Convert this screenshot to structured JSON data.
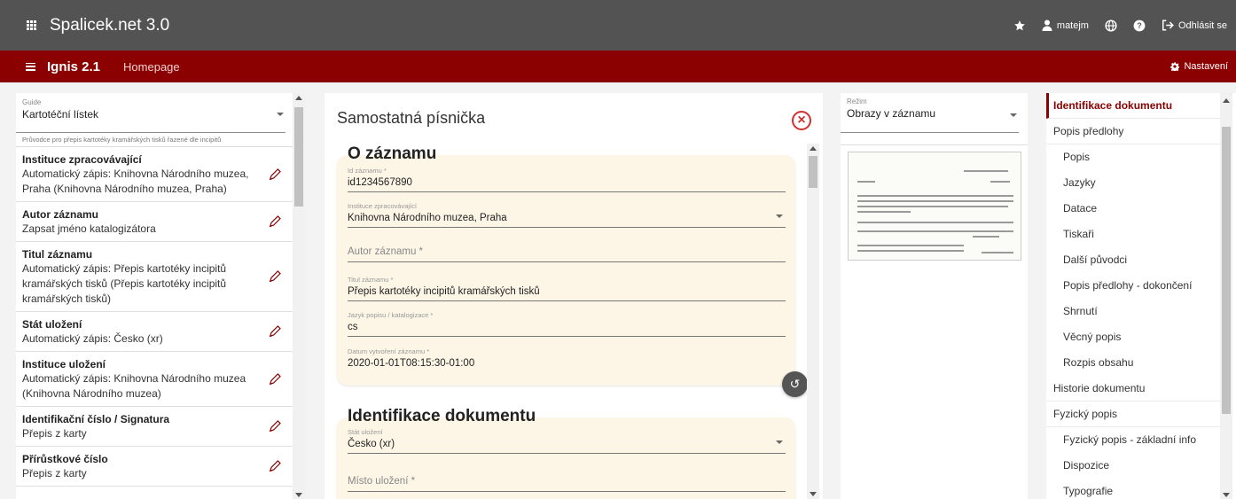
{
  "app": {
    "title": "Spalicek.net 3.0",
    "user": "matejm",
    "logout": "Odhlásit se"
  },
  "subbar": {
    "title": "Ignis 2.1",
    "homepage": "Homepage",
    "settings": "Nastavení"
  },
  "guide": {
    "label": "Guide",
    "value": "Kartotéční lístek",
    "hint": "Průvodce pro přepis kartotéky kramářských tisků řazené dle incipitů",
    "items": [
      {
        "title": "Instituce zpracovávající",
        "desc": "Automatický zápis: Knihovna Národního muzea, Praha (Knihovna Národního muzea, Praha)"
      },
      {
        "title": "Autor záznamu",
        "desc": "Zapsat jméno katalogizátora"
      },
      {
        "title": "Titul záznamu",
        "desc": "Automatický zápis: Přepis kartotéky incipitů kramářských tisků (Přepis kartotéky incipitů kramářských tisků)"
      },
      {
        "title": "Stát uložení",
        "desc": "Automatický zápis: Česko (xr)"
      },
      {
        "title": "Instituce uložení",
        "desc": "Automatický zápis: Knihovna Národního muzea (Knihovna Národního muzea)"
      },
      {
        "title": "Identifikační číslo / Signatura",
        "desc": "Přepis z karty"
      },
      {
        "title": "Přírůstkové číslo",
        "desc": "Přepis z karty"
      }
    ]
  },
  "form": {
    "title": "Samostatná písnička",
    "section1": {
      "title": "O záznamu",
      "fields": [
        {
          "label": "Id záznamu *",
          "value": "id1234567890"
        },
        {
          "label": "Instituce zpracovávající",
          "value": "Knihovna Národního muzea, Praha"
        },
        {
          "placeholder": "Autor záznamu *"
        },
        {
          "label": "Titul záznamu *",
          "value": "Přepis kartotéky incipitů kramářských tisků"
        },
        {
          "label": "Jazyk popisu / katalogizace *",
          "value": "cs"
        },
        {
          "label": "Datum vytvoření záznamu *",
          "value": "2020-01-01T08:15:30-01:00"
        }
      ]
    },
    "section2": {
      "title": "Identifikace dokumentu",
      "fields": [
        {
          "label": "Stát uložení",
          "value": "Česko (xr)"
        },
        {
          "placeholder": "Místo uložení *"
        }
      ]
    }
  },
  "images": {
    "label": "Režim",
    "value": "Obrazy v záznamu"
  },
  "nav": {
    "items": [
      {
        "label": "Identifikace dokumentu",
        "active": true
      },
      {
        "label": "Popis předlohy"
      },
      {
        "label": "Popis",
        "sub": true
      },
      {
        "label": "Jazyky",
        "sub": true
      },
      {
        "label": "Datace",
        "sub": true
      },
      {
        "label": "Tiskaři",
        "sub": true
      },
      {
        "label": "Další původci",
        "sub": true
      },
      {
        "label": "Popis předlohy - dokončení",
        "sub": true
      },
      {
        "label": "Shrnutí",
        "sub": true
      },
      {
        "label": "Věcný popis",
        "sub": true
      },
      {
        "label": "Rozpis obsahu",
        "sub": true
      },
      {
        "label": "Historie dokumentu"
      },
      {
        "label": "Fyzický popis"
      },
      {
        "label": "Fyzický popis - základní info",
        "sub": true
      },
      {
        "label": "Dispozice",
        "sub": true
      },
      {
        "label": "Typografie",
        "sub": true
      }
    ]
  },
  "colors": {
    "topbar": "#535353",
    "accent": "#8b0000",
    "card": "#fdf6e7",
    "close": "#d32f2f"
  }
}
